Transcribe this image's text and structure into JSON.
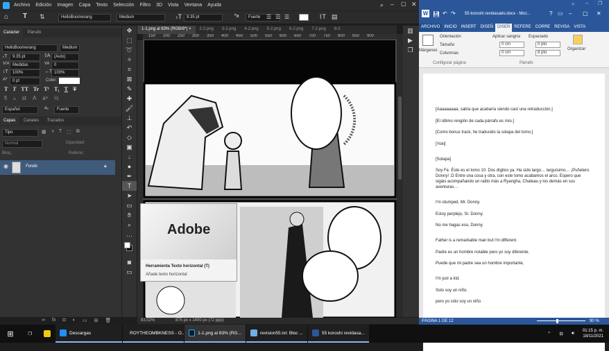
{
  "photoshop": {
    "menu": [
      "Archivo",
      "Edición",
      "Imagen",
      "Capa",
      "Texto",
      "Selección",
      "Filtro",
      "3D",
      "Vista",
      "Ventana",
      "Ayuda"
    ],
    "options": {
      "font_family": "HelloBoomerang",
      "font_style": "Medium",
      "font_size": "9.35 pt",
      "antialias": "Fuerte"
    },
    "char_panel": {
      "tabs": [
        "Carácter",
        "Párrafo"
      ],
      "font_family": "HelloBoomerang",
      "font_style": "Medium",
      "size": "9.35 pt",
      "leading": "(Auto)",
      "kerning": "Medidas",
      "tracking": "0",
      "vscale": "100%",
      "hscale": "100%",
      "baseline": "0 pt",
      "color_label": "Color:",
      "styles": [
        "T",
        "T",
        "TT",
        "Tr",
        "T¹",
        "T₁",
        "T",
        "T"
      ],
      "language": "Español",
      "aa_label": "aₐ",
      "antialias": "Fuerte"
    },
    "layers_panel": {
      "tabs": [
        "Capas",
        "Canales",
        "Trazados"
      ],
      "search": "Tipo",
      "blend": "Normal",
      "opacity_label": "Opacidad:",
      "lock_label": "Bloq.:",
      "fill_label": "Relleno:",
      "layer_name": "Fondo"
    },
    "doc_tabs": [
      "1-1.png al 83% (RGB/8*) ×",
      "2-2.png",
      "3-2.png",
      "4-2.png",
      "5-2.png",
      "6-2.png",
      "7-2.png",
      "8-2."
    ],
    "ruler_ticks": [
      "150",
      "200",
      "250",
      "300",
      "350",
      "400",
      "450",
      "500",
      "550",
      "600",
      "650",
      "700",
      "750",
      "800",
      "850",
      "900"
    ],
    "status": {
      "zoom": "83,02%",
      "size": "875 px x 1400 px (72 ppp)"
    },
    "tooltip": {
      "banner": "Adobe",
      "title": "Herramienta Texto horizontal (T)",
      "desc": "Añade texto horizontal"
    }
  },
  "word": {
    "title": "55 koroshi revidasado.docx - Micr...",
    "tabs": [
      "ARCHIVO",
      "INICIO",
      "INSERT",
      "DISEÑ",
      "DISEÑ",
      "REFERE",
      "CORRE",
      "REVISA",
      "VISTA"
    ],
    "ribbon": {
      "margins": "Márgenes",
      "orientation": "Orientación",
      "size": "Tamaño",
      "columns": "Columnas",
      "indent_label": "Aplicar sangría",
      "spacing_label": "Espaciado",
      "indent_left": "0 cm",
      "indent_right": "0 cm",
      "space_before": "0 pto",
      "space_after": "8 pto",
      "arrange": "Organizar",
      "group_page": "Configurar página",
      "group_para": "Párrafo"
    },
    "paragraphs": [
      "[Aaaaaaaaa, sabía que acabaría siendo cast una retraducción.]",
      "[El último renglón de cada párrafo es mío.]",
      "[Como bonus track, he traducido la solapa del tomo.]",
      "[Yoki]",
      "[Solapa]",
      "Soy Fe. Éste es el tomo 10. Dos dígitos ya. Ha sido largo… larguísimo… ¡Puñetero Donny! :D Entre una cosa y otra, con este tomo acabamos el arco. Espero que sigáis acompañando un ratito más a Ryangha, Chateau y los demás en sus aventuras…",
      "I'm stumped, Mr. Donny.",
      "Estoy perplejo, Sr. Donny.",
      "No me hagas eso, Donny.",
      "Father is a remarkable man but I'm different.",
      "Padre es un hombre notable pero yo soy diferente.",
      "Puede que mi padre sea un hombre importante,",
      "I'm just a kid.",
      "Solo soy un niño.",
      "pero yo sólo soy un niño"
    ],
    "status": {
      "page": "PÁGINA 1 DE 12",
      "zoom": "90 %"
    }
  },
  "taskbar": {
    "items": [
      {
        "label": "Descargas",
        "color": "#1e90ff"
      },
      {
        "label": "ROYTHEOMBKNESS - O...",
        "color": "#cc1b1b"
      },
      {
        "label": "1-1.png al 83% (RG...",
        "color": "#31a8ff"
      },
      {
        "label": "revision55.txt: Bloc ...",
        "color": "#6fb1e6"
      },
      {
        "label": "55 koroshi revidasa...",
        "color": "#2b579a"
      }
    ],
    "time": "01:15 p. m.",
    "date": "18/11/2021"
  }
}
